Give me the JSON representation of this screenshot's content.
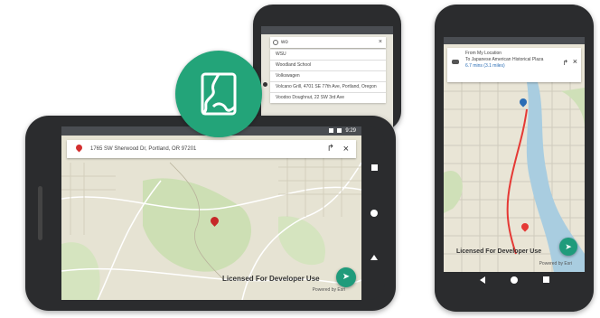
{
  "landscape_phone": {
    "status_time": "9:29",
    "search_text": "1765 SW Sherwood Dr, Portland, OR 97201",
    "licensed_label": "Licensed For Developer Use",
    "powered_label": "Powered by Esri",
    "fab_icon": "navigation-icon"
  },
  "top_phone": {
    "search_query": "wo",
    "results": [
      "WSU",
      "Woodland School",
      "Volkswagen",
      "Volcano Grill, 4701 SE 77th Ave, Portland, Oregon",
      "Voodoo Doughnut, 22 SW 3rd Ave"
    ]
  },
  "right_phone": {
    "route_from": "From My Location",
    "route_to": "To Japanese American Historical Plaza",
    "route_summary": "6.7 mins (3.1 miles)",
    "licensed_label": "Licensed For Developer Use",
    "powered_label": "Powered by Esri"
  },
  "badge": {
    "icon": "map-outline-icon"
  },
  "colors": {
    "accent": "#1f9b7b",
    "phone": "#2b2c2e",
    "route": "#e53935",
    "water": "#a9cde0"
  }
}
